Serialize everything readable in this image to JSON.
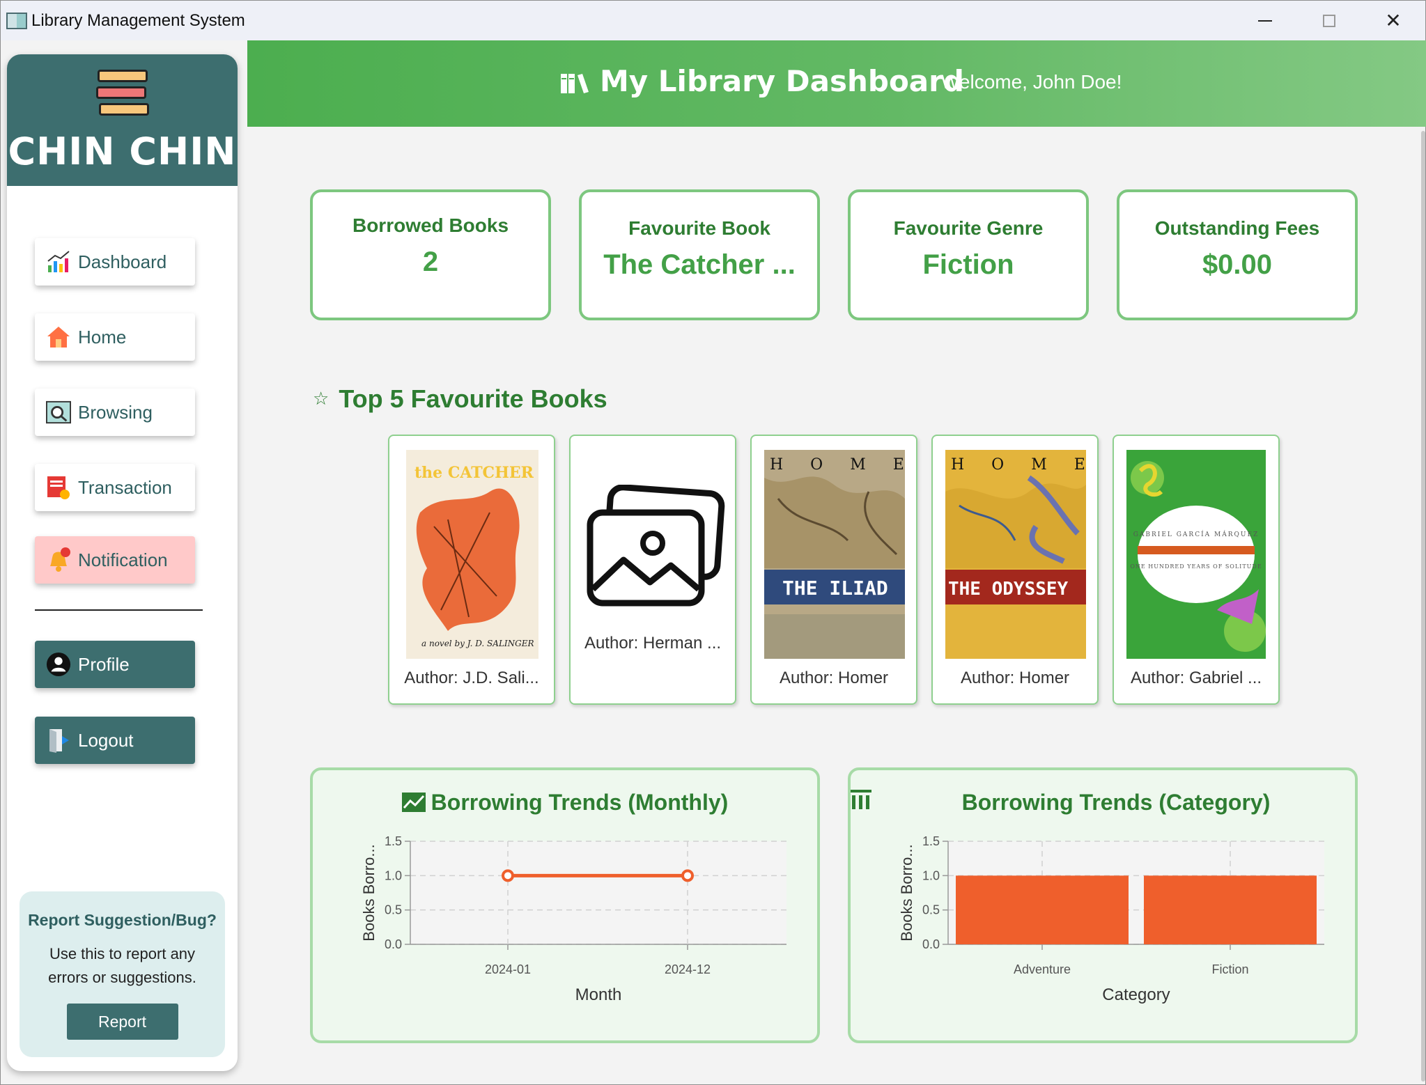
{
  "window": {
    "title": "Library Management System"
  },
  "brand": {
    "name": "CHIN CHIN"
  },
  "nav": {
    "dashboard": "Dashboard",
    "home": "Home",
    "browsing": "Browsing",
    "transaction": "Transaction",
    "notification": "Notification",
    "profile": "Profile",
    "logout": "Logout"
  },
  "report": {
    "heading": "Report Suggestion/Bug?",
    "text": "Use this to report any errors or suggestions.",
    "button": "Report"
  },
  "header": {
    "title": "My Library Dashboard",
    "welcome": "Welcome, John Doe!"
  },
  "stats": [
    {
      "title": "Borrowed Books",
      "value": "2"
    },
    {
      "title": "Favourite Book",
      "value": "The Catcher ..."
    },
    {
      "title": "Favourite Genre",
      "value": "Fiction"
    },
    {
      "title": "Outstanding Fees",
      "value": "$0.00"
    }
  ],
  "favourites": {
    "title": "Top 5 Favourite Books",
    "books": [
      {
        "author": "Author: J.D. Sali...",
        "cover_text_top": "the CATCHER in the RYE",
        "cover_text_bottom": "a novel by J. D. SALINGER"
      },
      {
        "author": "Author: Herman ...",
        "cover_text_top": "",
        "cover_text_bottom": ""
      },
      {
        "author": "Author: Homer",
        "cover_text_top": "H O M E R",
        "cover_text_bottom": "THE ILIAD"
      },
      {
        "author": "Author: Homer",
        "cover_text_top": "H O M E R",
        "cover_text_bottom": "THE ODYSSEY"
      },
      {
        "author": "Author: Gabriel ...",
        "cover_text_top": "GABRIEL GARCÍA MÁRQUEZ",
        "cover_text_bottom": "ONE HUNDRED YEARS OF SOLITUDE"
      }
    ]
  },
  "colors": {
    "accent": "#43a047",
    "sidebar": "#3d6e6f",
    "bar": "#ef5f2c"
  },
  "chart_data": [
    {
      "type": "line",
      "title": "Borrowing Trends (Monthly)",
      "xlabel": "Month",
      "ylabel": "Books Borro...",
      "x": [
        "2024-01",
        "2024-12"
      ],
      "values": [
        1.0,
        1.0
      ],
      "ylim": [
        0,
        1.5
      ],
      "yticks": [
        "0.0",
        "0.5",
        "1.0",
        "1.5"
      ],
      "grid": true
    },
    {
      "type": "bar",
      "title": "Borrowing Trends (Category)",
      "xlabel": "Category",
      "ylabel": "Books Borro...",
      "categories": [
        "Adventure",
        "Fiction"
      ],
      "values": [
        1.0,
        1.0
      ],
      "ylim": [
        0,
        1.5
      ],
      "yticks": [
        "0.0",
        "0.5",
        "1.0",
        "1.5"
      ],
      "grid": true
    }
  ]
}
